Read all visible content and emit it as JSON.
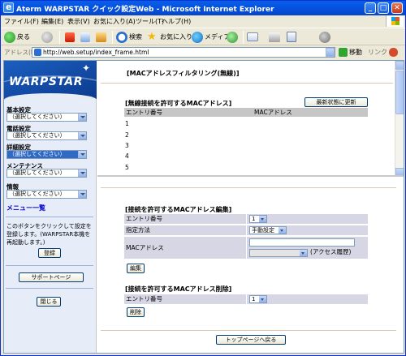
{
  "window": {
    "title": "Aterm WARPSTAR クイック設定Web - Microsoft Internet Explorer",
    "min": "_",
    "max": "□",
    "close": "✕"
  },
  "menu": [
    "ファイル(F)",
    "編集(E)",
    "表示(V)",
    "お気に入り(A)",
    "ツール(T)",
    "ヘルプ(H)"
  ],
  "toolbar": {
    "back": "戻る",
    "search": "検索",
    "favorites": "お気に入り",
    "media": "メディア"
  },
  "address": {
    "label": "アドレス(D)",
    "url": "http://web.setup/index_frame.html",
    "go": "移動",
    "links": "リンク »"
  },
  "logo": {
    "text": "WARPSTAR"
  },
  "sidebar": {
    "groups": [
      {
        "label": "基本設定",
        "value": "（選択してください）"
      },
      {
        "label": "電話設定",
        "value": "（選択してください）"
      },
      {
        "label": "詳細設定",
        "value": "（選択してください）"
      },
      {
        "label": "メンテナンス",
        "value": "（選択してください）"
      },
      {
        "label": "情報",
        "value": "（選択してください）"
      }
    ],
    "menu_link": "メニュー一覧",
    "note": "このボタンをクリックして設定を登録します。(WARPSTAR本機を再起動します。)",
    "register_button": "登録",
    "support_button": "サポートページ",
    "close_button": "閉じる"
  },
  "top_frame": {
    "heading": "[MACアドレスフィルタリング(無線)]",
    "allowed_title": "[無線接続を許可するMACアドレス]",
    "refresh_button": "最新状態に更新",
    "columns": [
      "エントリ番号",
      "MACアドレス"
    ],
    "rows": [
      "1",
      "2",
      "3",
      "4",
      "5"
    ]
  },
  "bottom_frame": {
    "edit_title": "[接続を許可するMACアドレス編集]",
    "entry_label": "エントリ番号",
    "entry_value": "1",
    "method_label": "指定方法",
    "method_value": "手動設定",
    "mac_label": "MACアドレス",
    "mac_input": "",
    "access_history": "(アクセス履歴)",
    "edit_button": "編集",
    "delete_title": "[接続を許可するMACアドレス削除]",
    "delete_entry_label": "エントリ番号",
    "delete_entry_value": "1",
    "delete_button": "削除",
    "top_page_button": "トップページへ戻る"
  }
}
